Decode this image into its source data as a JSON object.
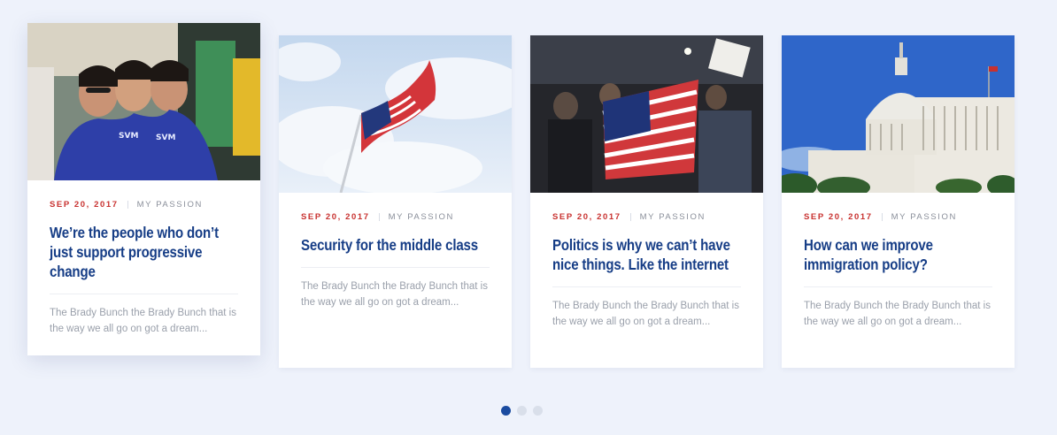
{
  "cards": [
    {
      "date": "SEP 20, 2017",
      "category": "MY PASSION",
      "title": "We’re the people who don’t just support progressive change",
      "excerpt": "The Brady Bunch the Brady Bunch that is the way we all go on got a dream...",
      "image": "group-of-smiling-girls-photo"
    },
    {
      "date": "SEP 20, 2017",
      "category": "MY PASSION",
      "title": "Security for the middle class",
      "excerpt": "The Brady Bunch the Brady Bunch that is the way we all go on got a dream...",
      "image": "american-flag-sky-photo"
    },
    {
      "date": "SEP 20, 2017",
      "category": "MY PASSION",
      "title": "Politics is why we can’t have nice things. Like the internet",
      "excerpt": "The Brady Bunch the Brady Bunch that is the way we all go on got a dream...",
      "image": "rally-crowd-flag-photo"
    },
    {
      "date": "SEP 20, 2017",
      "category": "MY PASSION",
      "title": "How can we improve immigration policy?",
      "excerpt": "The Brady Bunch the Brady Bunch that is the way we all go on got a dream...",
      "image": "capitol-building-photo"
    }
  ],
  "pagination": {
    "total": 3,
    "active": 1
  },
  "colors": {
    "background": "#eef2fb",
    "accent_red": "#c8312f",
    "title_blue": "#163d86",
    "dot_active": "#1a4ba0",
    "dot_inactive": "#d9dfea"
  }
}
